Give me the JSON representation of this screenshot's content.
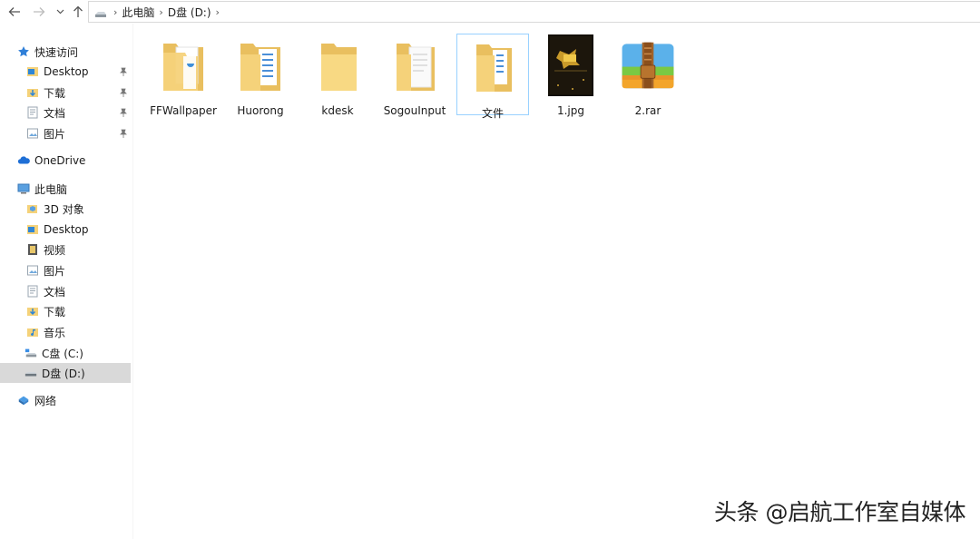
{
  "address_bar": {
    "breadcrumbs": [
      "此电脑",
      "D盘 (D:)"
    ]
  },
  "sidebar": {
    "quick_access": {
      "label": "快速访问",
      "items": [
        {
          "label": "Desktop",
          "icon": "desktop-folder-icon",
          "pinned": true
        },
        {
          "label": "下载",
          "icon": "downloads-folder-icon",
          "pinned": true
        },
        {
          "label": "文档",
          "icon": "documents-folder-icon",
          "pinned": true
        },
        {
          "label": "图片",
          "icon": "pictures-folder-icon",
          "pinned": true
        }
      ]
    },
    "onedrive": {
      "label": "OneDrive"
    },
    "this_pc": {
      "label": "此电脑",
      "items": [
        {
          "label": "3D 对象",
          "icon": "3d-objects-folder-icon"
        },
        {
          "label": "Desktop",
          "icon": "desktop-folder-icon"
        },
        {
          "label": "视频",
          "icon": "videos-folder-icon"
        },
        {
          "label": "图片",
          "icon": "pictures-folder-icon"
        },
        {
          "label": "文档",
          "icon": "documents-folder-icon"
        },
        {
          "label": "下载",
          "icon": "downloads-folder-icon"
        },
        {
          "label": "音乐",
          "icon": "music-folder-icon"
        },
        {
          "label": "C盘 (C:)",
          "icon": "system-drive-icon"
        },
        {
          "label": "D盘 (D:)",
          "icon": "drive-icon",
          "selected": true
        }
      ]
    },
    "network": {
      "label": "网络"
    }
  },
  "files": [
    {
      "name": "FFWallpaper",
      "type": "folder"
    },
    {
      "name": "Huorong",
      "type": "folder"
    },
    {
      "name": "kdesk",
      "type": "folder"
    },
    {
      "name": "SogouInput",
      "type": "folder"
    },
    {
      "name": "文件",
      "type": "folder",
      "focused": true
    },
    {
      "name": "1.jpg",
      "type": "image"
    },
    {
      "name": "2.rar",
      "type": "archive"
    }
  ],
  "watermark": "头条 @启航工作室自媒体",
  "colors": {
    "folder": "#f5d27a",
    "selection": "#d9d9d9",
    "focus_border": "#99d1ff",
    "onedrive": "#1e6fd6"
  }
}
